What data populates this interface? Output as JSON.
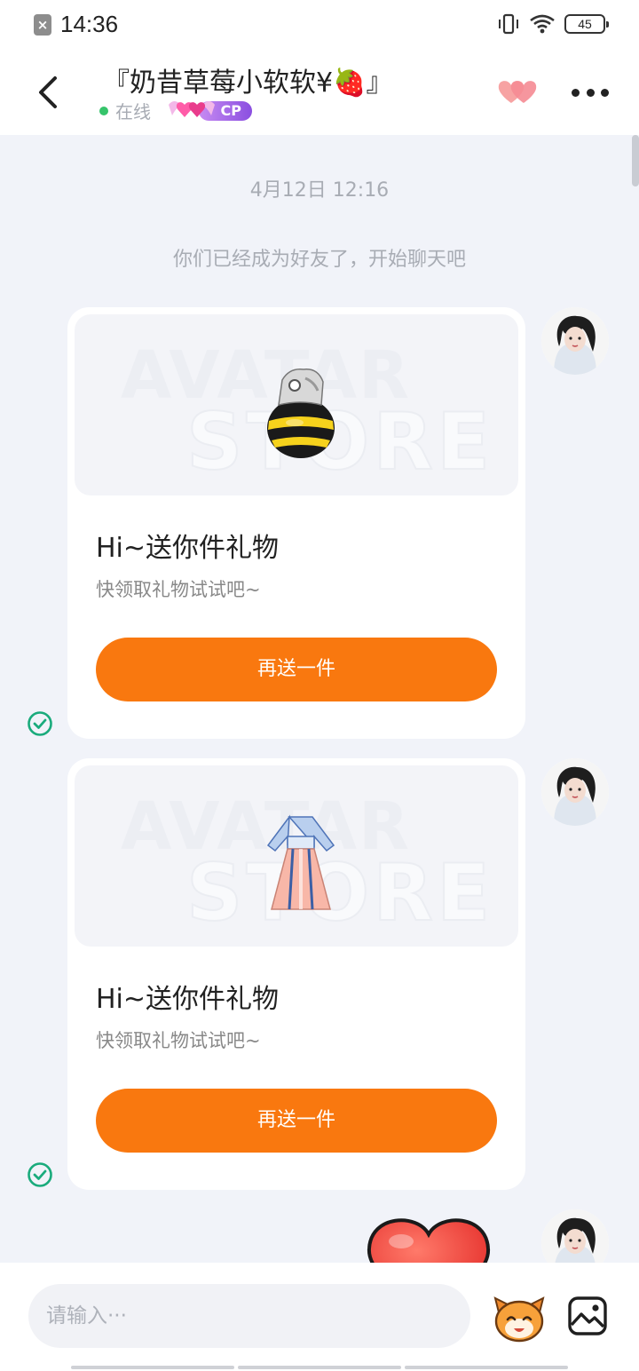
{
  "status_bar": {
    "time": "14:36",
    "battery": "45"
  },
  "header": {
    "title": "『奶昔草莓小软软¥🍓』",
    "online_status": "在线",
    "cp_badge": "CP"
  },
  "chat": {
    "timestamp": "4月12日 12:16",
    "system_message": "你们已经成为好友了，开始聊天吧",
    "messages": [
      {
        "item": "bee-hat",
        "title": "Hi~送你件礼物",
        "subtitle": "快领取礼物试试吧~",
        "button": "再送一件"
      },
      {
        "item": "hanfu-dress",
        "title": "Hi~送你件礼物",
        "subtitle": "快领取礼物试试吧~",
        "button": "再送一件"
      }
    ],
    "watermark_top": "AVATAR",
    "watermark_bottom": "STORE"
  },
  "input_bar": {
    "placeholder": "请输入···"
  },
  "colors": {
    "accent": "#f9780f",
    "online": "#36c46b",
    "check": "#1aab7c",
    "background": "#f1f3f9"
  }
}
